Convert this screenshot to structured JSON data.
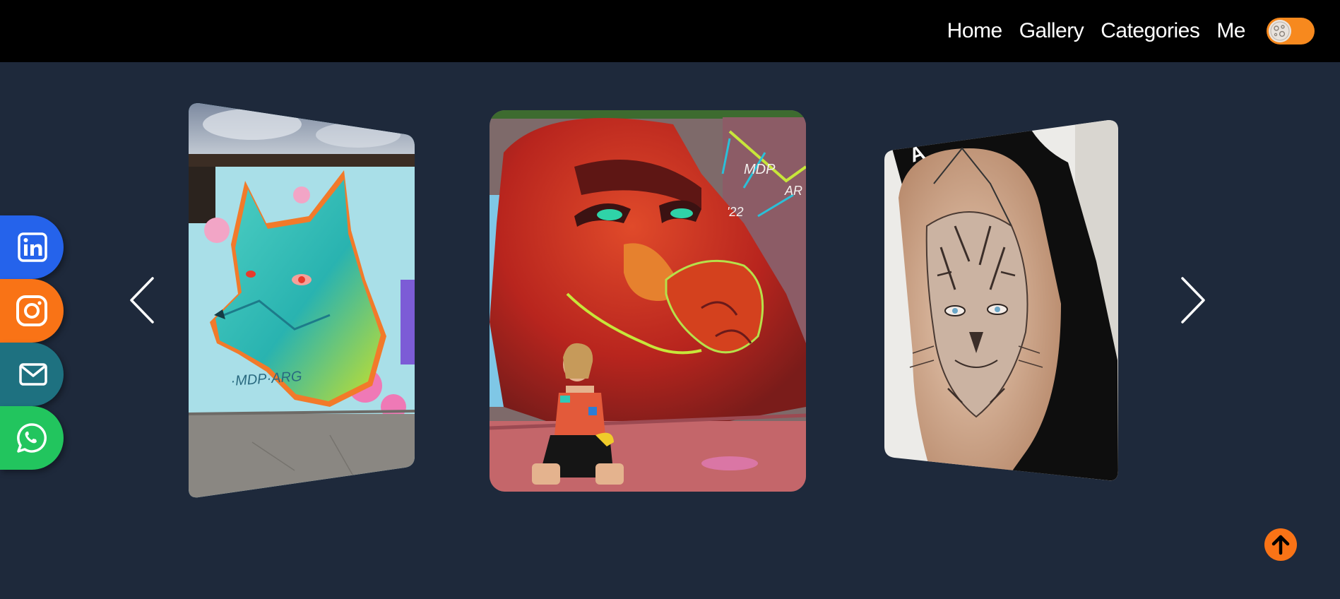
{
  "nav": {
    "items": [
      {
        "label": "Home"
      },
      {
        "label": "Gallery"
      },
      {
        "label": "Categories"
      },
      {
        "label": "Me"
      }
    ],
    "theme_toggle": {
      "icon": "moon-icon",
      "state": "dark"
    }
  },
  "social": [
    {
      "name": "linkedin",
      "icon": "linkedin-icon",
      "color": "#2563eb"
    },
    {
      "name": "instagram",
      "icon": "instagram-icon",
      "color": "#f97316"
    },
    {
      "name": "email",
      "icon": "mail-icon",
      "color": "#1e7180"
    },
    {
      "name": "whatsapp",
      "icon": "whatsapp-icon",
      "color": "#22c55e"
    }
  ],
  "carousel": {
    "prev_icon": "chevron-left-icon",
    "next_icon": "chevron-right-icon",
    "slides": [
      {
        "subject": "graffiti mural of a teal wolf",
        "mural_text": "MDP-ARG"
      },
      {
        "subject": "graffiti mural of a red gorilla with a woman sitting in front",
        "mural_text": "MDP AR '22"
      },
      {
        "subject": "realistic tiger tattoo on a shoulder"
      }
    ]
  },
  "back_to_top": {
    "icon": "arrow-up-icon"
  },
  "colors": {
    "background": "#1e293b",
    "topbar": "#000000",
    "accent": "#f97316"
  }
}
